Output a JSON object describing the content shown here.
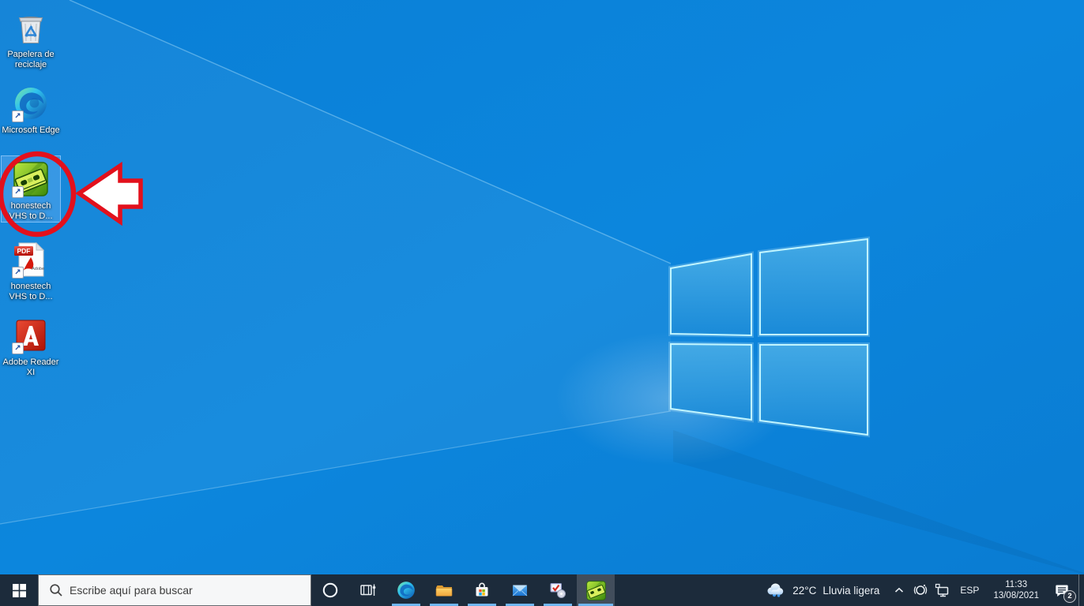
{
  "colors": {
    "wallpaper_blue": "#0b83da",
    "taskbar": "#1c2b3b",
    "annotation_red": "#e3101c",
    "taskbar_underline": "#6fb6f0"
  },
  "desktop": {
    "icons": [
      {
        "name": "recycle-bin",
        "label": "Papelera de reciclaje",
        "shortcut": false,
        "selected": false
      },
      {
        "name": "microsoft-edge",
        "label": "Microsoft Edge",
        "shortcut": true,
        "selected": false
      },
      {
        "name": "honestech-vhs-app",
        "label": "honestech VHS to D...",
        "shortcut": true,
        "selected": true
      },
      {
        "name": "honestech-vhs-pdf",
        "label": "honestech VHS to D...",
        "shortcut": true,
        "selected": false
      },
      {
        "name": "adobe-reader-xi",
        "label": "Adobe Reader XI",
        "shortcut": true,
        "selected": false
      }
    ],
    "annotation": {
      "type": "circle-and-arrow",
      "color": "#e3101c",
      "target_label": "honestech VHS to D..."
    }
  },
  "taskbar": {
    "search": {
      "placeholder": "Escribe aquí para buscar"
    },
    "pinned_apps": [
      "microsoft-edge",
      "file-explorer",
      "microsoft-store",
      "mail",
      "software-installer",
      "honestech-vhs"
    ],
    "active_app": "honestech-vhs",
    "tray": {
      "temperature": "22°C",
      "weather_condition": "Lluvia ligera",
      "language": "ESP",
      "time": "11:33",
      "date": "13/08/2021",
      "notification_badge": "2"
    }
  }
}
